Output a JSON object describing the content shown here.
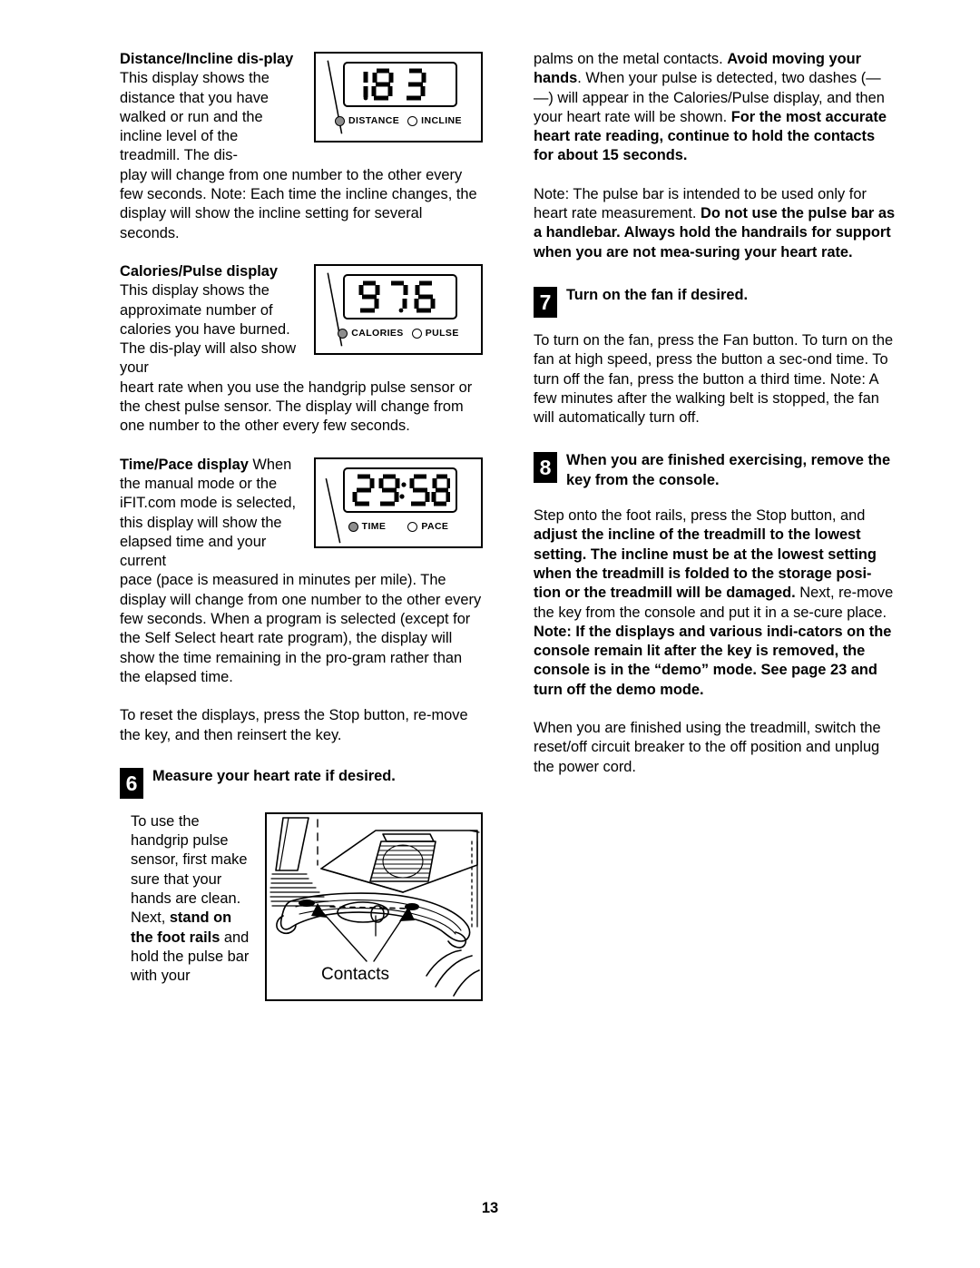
{
  "page": {
    "number": "13"
  },
  "left_column": {
    "distance_incline": {
      "heading_bold": "Distance/Incline dis-play",
      "body_first": " This display shows the distance that you have walked or run and the incline level of the treadmill. The dis-",
      "body_rest": "play will change from one number to the other every few seconds. Note: Each time the incline changes, the display will show the incline setting for several seconds.",
      "display": {
        "value": "1.83",
        "led_left_label": "DISTANCE",
        "led_left_state": "filled",
        "led_right_label": "INCLINE",
        "led_right_state": "hollow"
      }
    },
    "calories_pulse": {
      "heading_bold": "Calories/Pulse display",
      "body_first": " This display shows the approximate number of calories you have burned. The dis-play will also show your",
      "body_rest": "heart rate when you use the handgrip pulse sensor or the chest pulse sensor. The display will change from one number to the other every few seconds.",
      "display": {
        "value": "97.6",
        "led_left_label": "CALORIES",
        "led_left_state": "filled",
        "led_right_label": "PULSE",
        "led_right_state": "hollow"
      }
    },
    "time_pace": {
      "heading_bold": "Time/Pace display",
      "body_first": " When the manual mode or the iFIT.com mode is selected, this display will show the elapsed time and your current",
      "body_rest": "pace (pace is measured in minutes per mile). The display will change from one number to the other every few seconds. When a program is selected (except for the Self Select heart rate program), the display will show the time remaining in the pro-gram rather than the elapsed time.",
      "display": {
        "value": "29:58",
        "led_left_label": "TIME",
        "led_left_state": "filled",
        "led_right_label": "PACE",
        "led_right_state": "hollow"
      }
    },
    "reset_note": "To reset the displays, press the Stop button, re-move the key, and then reinsert the key.",
    "step6": {
      "number": "6",
      "heading": "Measure your heart rate if desired.",
      "body_part1": "To use the handgrip pulse sensor, first make sure that your hands are clean. Next, ",
      "body_bold": "stand on the foot rails",
      "body_part2": " and hold the pulse bar with your",
      "figure_label": "Contacts"
    }
  },
  "right_column": {
    "pulse_continued": {
      "part1": "palms on the metal contacts. ",
      "bold1": "Avoid moving your hands",
      "part2": ". When your pulse is detected, two dashes (— —) will appear in the Calories/Pulse display, and then your heart rate will be shown. ",
      "bold2": "For the most accurate heart rate reading, continue to hold the contacts for about 15 seconds."
    },
    "pulse_note": {
      "part1": "Note: The pulse bar is intended to be used only for heart rate measurement. ",
      "bold1": "Do not use the pulse bar as a handlebar. Always hold the handrails for support when you are not mea-suring your heart rate."
    },
    "step7": {
      "number": "7",
      "heading": "Turn on the fan if desired.",
      "body": "To turn on the fan, press the Fan button. To turn on the fan at high speed, press the button a sec-ond time. To turn off the fan, press the button a third time. Note: A few minutes after the walking belt is stopped, the fan will automatically turn off."
    },
    "step8": {
      "number": "8",
      "heading": "When you are finished exercising, remove the key from the console.",
      "body_part1": "Step onto the foot rails, press the Stop button, and ",
      "body_bold1": "adjust the incline of the treadmill to the lowest setting. The incline must be at the lowest setting when the treadmill is folded to the storage posi-tion or the treadmill will be damaged.",
      "body_part2": " Next, re-move the key from the console and put it in a se-cure place. ",
      "body_bold2": "Note: If the displays and various indi-cators on the console remain lit after the key is removed, the console is in the “demo” mode. See page 23 and turn off the demo mode.",
      "closing": "When you are finished using the treadmill, switch the reset/off circuit breaker to the off position and unplug the power cord."
    }
  }
}
